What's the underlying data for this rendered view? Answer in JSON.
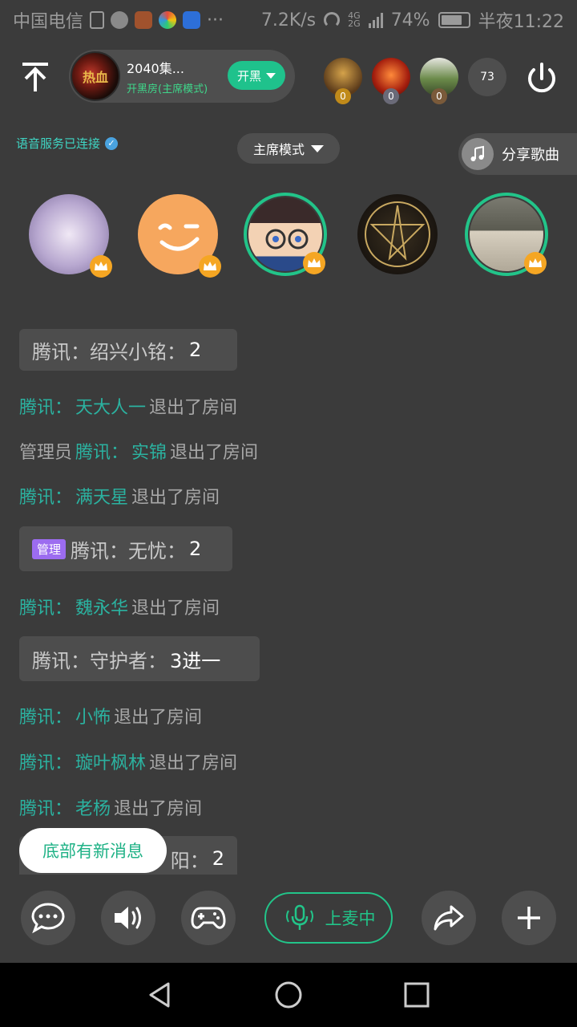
{
  "status_bar": {
    "carrier": "中国电信",
    "net_speed": "7.2K/s",
    "net_top": "4G",
    "net_bottom": "2G",
    "battery": "74%",
    "time": "半夜11:22",
    "more": "···"
  },
  "room": {
    "name": "2040集...",
    "mode_line": "开黑房(主席模式)",
    "action_label": "开黑",
    "thumb_text": "热血",
    "audience": [
      {
        "count": "0",
        "badge_color": "#c08a1a"
      },
      {
        "count": "0",
        "badge_color": "#6a6a78"
      },
      {
        "count": "0",
        "badge_color": "#7a5a3a"
      }
    ],
    "audience_total": "73"
  },
  "voice_status": "语音服务已连接",
  "mode_select": "主席模式",
  "share_song": "分享歌曲",
  "messages": [
    {
      "prefix": "腾讯：绍兴小铭：",
      "value": "2"
    },
    {
      "platform": "腾讯：",
      "name": "天大人一",
      "action": "退出了房间"
    },
    {
      "role": "管理员",
      "platform": "腾讯：",
      "name": "实锦",
      "action": "退出了房间"
    },
    {
      "platform": "腾讯：",
      "name": "满天星",
      "action": "退出了房间"
    },
    {
      "tag": "管理",
      "prefix": "腾讯：无忧：",
      "value": "2"
    },
    {
      "platform": "腾讯：",
      "name": "魏永华",
      "action": "退出了房间"
    },
    {
      "prefix": "腾讯：守护者：",
      "value": "3进一"
    },
    {
      "platform": "腾讯：",
      "name": "小怖",
      "action": "退出了房间"
    },
    {
      "platform": "腾讯：",
      "name": "璇叶枫林",
      "action": "退出了房间"
    },
    {
      "platform": "腾讯：",
      "name": "老杨",
      "action": "退出了房间"
    },
    {
      "prefix": "阳：",
      "value": "2"
    }
  ],
  "new_message_toast": "底部有新消息",
  "toolbar": {
    "mic_label": "上麦中"
  },
  "colors": {
    "accent": "#22c489",
    "name_teal": "#2bb2a0",
    "crown": "#f5a623",
    "admin_tag": "#9c6cf0"
  }
}
